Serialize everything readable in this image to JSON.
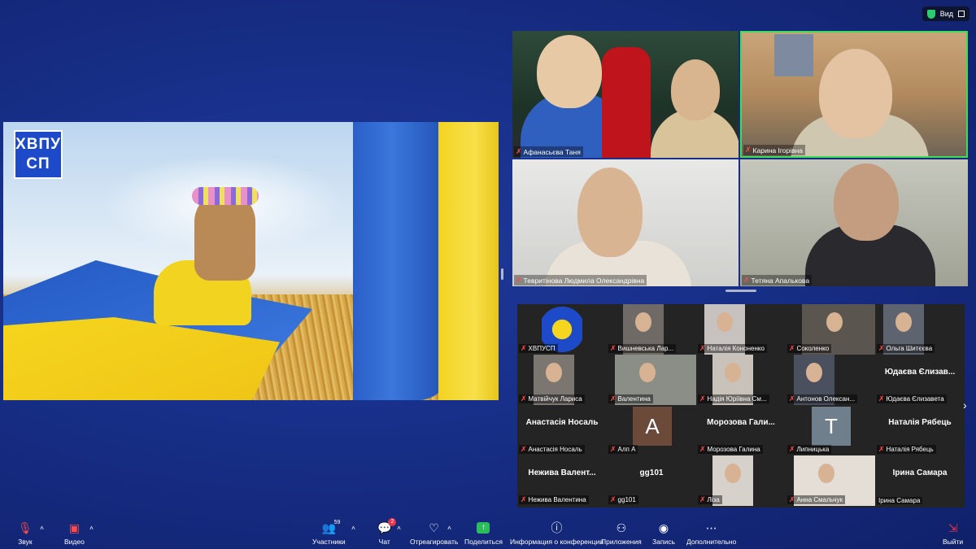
{
  "view_button": {
    "label": "Вид"
  },
  "shared_screen": {
    "logo_text": "ХВПУ СП"
  },
  "featured": [
    {
      "name": "Афанасьєва Таня"
    },
    {
      "name": "Карина Ігорівна"
    },
    {
      "name": "Тевритінова Людмила Олександрівна"
    },
    {
      "name": "Тетяна Апалькова"
    }
  ],
  "gallery": [
    {
      "display": "",
      "label": "ХВПУСП",
      "kind": "logo"
    },
    {
      "display": "",
      "label": "Вишневська Лар...",
      "kind": "video"
    },
    {
      "display": "",
      "label": "Наталія Кононенко",
      "kind": "video"
    },
    {
      "display": "",
      "label": "Соколенко",
      "kind": "video"
    },
    {
      "display": "",
      "label": "Ольга Шитєєва",
      "kind": "video"
    },
    {
      "display": "",
      "label": "Матвійчук Лариса",
      "kind": "video"
    },
    {
      "display": "",
      "label": "Валентина",
      "kind": "video"
    },
    {
      "display": "",
      "label": "Надія Юріївна См...",
      "kind": "video"
    },
    {
      "display": "",
      "label": "Антонов Олексан...",
      "kind": "video"
    },
    {
      "display": "Юдаєва Єлизав...",
      "label": "Юдаєва Єлизавета",
      "kind": "name"
    },
    {
      "display": "Анастасія Носаль",
      "label": "Анастасія Носаль",
      "kind": "name"
    },
    {
      "display": "A",
      "label": "Алп А",
      "kind": "letter",
      "color": "#6b4a3a"
    },
    {
      "display": "Морозова Гали...",
      "label": "Морозова Галина",
      "kind": "name"
    },
    {
      "display": "T",
      "label": "Липницька",
      "kind": "letter",
      "color": "#6f7f8c"
    },
    {
      "display": "Наталія Рябець",
      "label": "Наталія Рябець",
      "kind": "name"
    },
    {
      "display": "Нежива Валент...",
      "label": "Нежива Валентина",
      "kind": "name"
    },
    {
      "display": "gg101",
      "label": "gg101",
      "kind": "name"
    },
    {
      "display": "",
      "label": "Ліза",
      "kind": "video"
    },
    {
      "display": "",
      "label": "Анна Смальчук",
      "kind": "video"
    },
    {
      "display": "Ірина Самара",
      "label": "Ірина Самара",
      "kind": "name-nomic"
    }
  ],
  "toolbar": {
    "audio": "Звук",
    "video": "Видео",
    "participants": "Участники",
    "participants_count": "59",
    "chat": "Чат",
    "chat_badge": "2",
    "react": "Отреагировать",
    "share": "Поделиться",
    "info": "Информация о конференции",
    "apps": "Приложения",
    "record": "Запись",
    "more": "Дополнительно",
    "leave": "Выйти"
  },
  "colors": {
    "background": "#18308a",
    "active_speaker_border": "#3fdc5a",
    "mic_muted": "#ff4b4b",
    "share_green": "#2bbd5c",
    "leave_red": "#e8344a"
  }
}
